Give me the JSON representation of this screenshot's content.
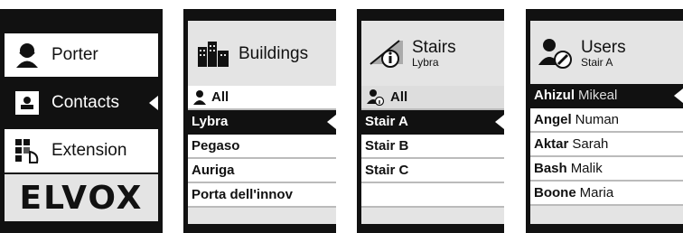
{
  "panel_main": {
    "items": [
      {
        "label": "Porter",
        "icon": "porter-icon"
      },
      {
        "label": "Contacts",
        "icon": "contacts-card-icon",
        "selected": true
      },
      {
        "label": "Extension",
        "icon": "extension-icon"
      }
    ],
    "logo": "ELVOX"
  },
  "panel_buildings": {
    "title": "Buildings",
    "icon": "buildings-icon",
    "all_label": "All",
    "rows": [
      "Lybra",
      "Pegaso",
      "Auriga",
      "Porta dell'innov"
    ],
    "selected_index": 0
  },
  "panel_stairs": {
    "title": "Stairs",
    "subtitle": "Lybra",
    "icon": "stairs-info-icon",
    "all_label": "All",
    "rows": [
      "Stair A",
      "Stair B",
      "Stair C",
      ""
    ],
    "selected_index": 0
  },
  "panel_users": {
    "title": "Users",
    "subtitle": "Stair A",
    "icon": "users-icon",
    "rows": [
      {
        "first": "Ahizul",
        "last": "Mikeal"
      },
      {
        "first": "Angel",
        "last": "Numan"
      },
      {
        "first": "Aktar",
        "last": "Sarah"
      },
      {
        "first": "Bash",
        "last": "Malik"
      },
      {
        "first": "Boone",
        "last": "Maria"
      }
    ],
    "selected_index": 0
  }
}
